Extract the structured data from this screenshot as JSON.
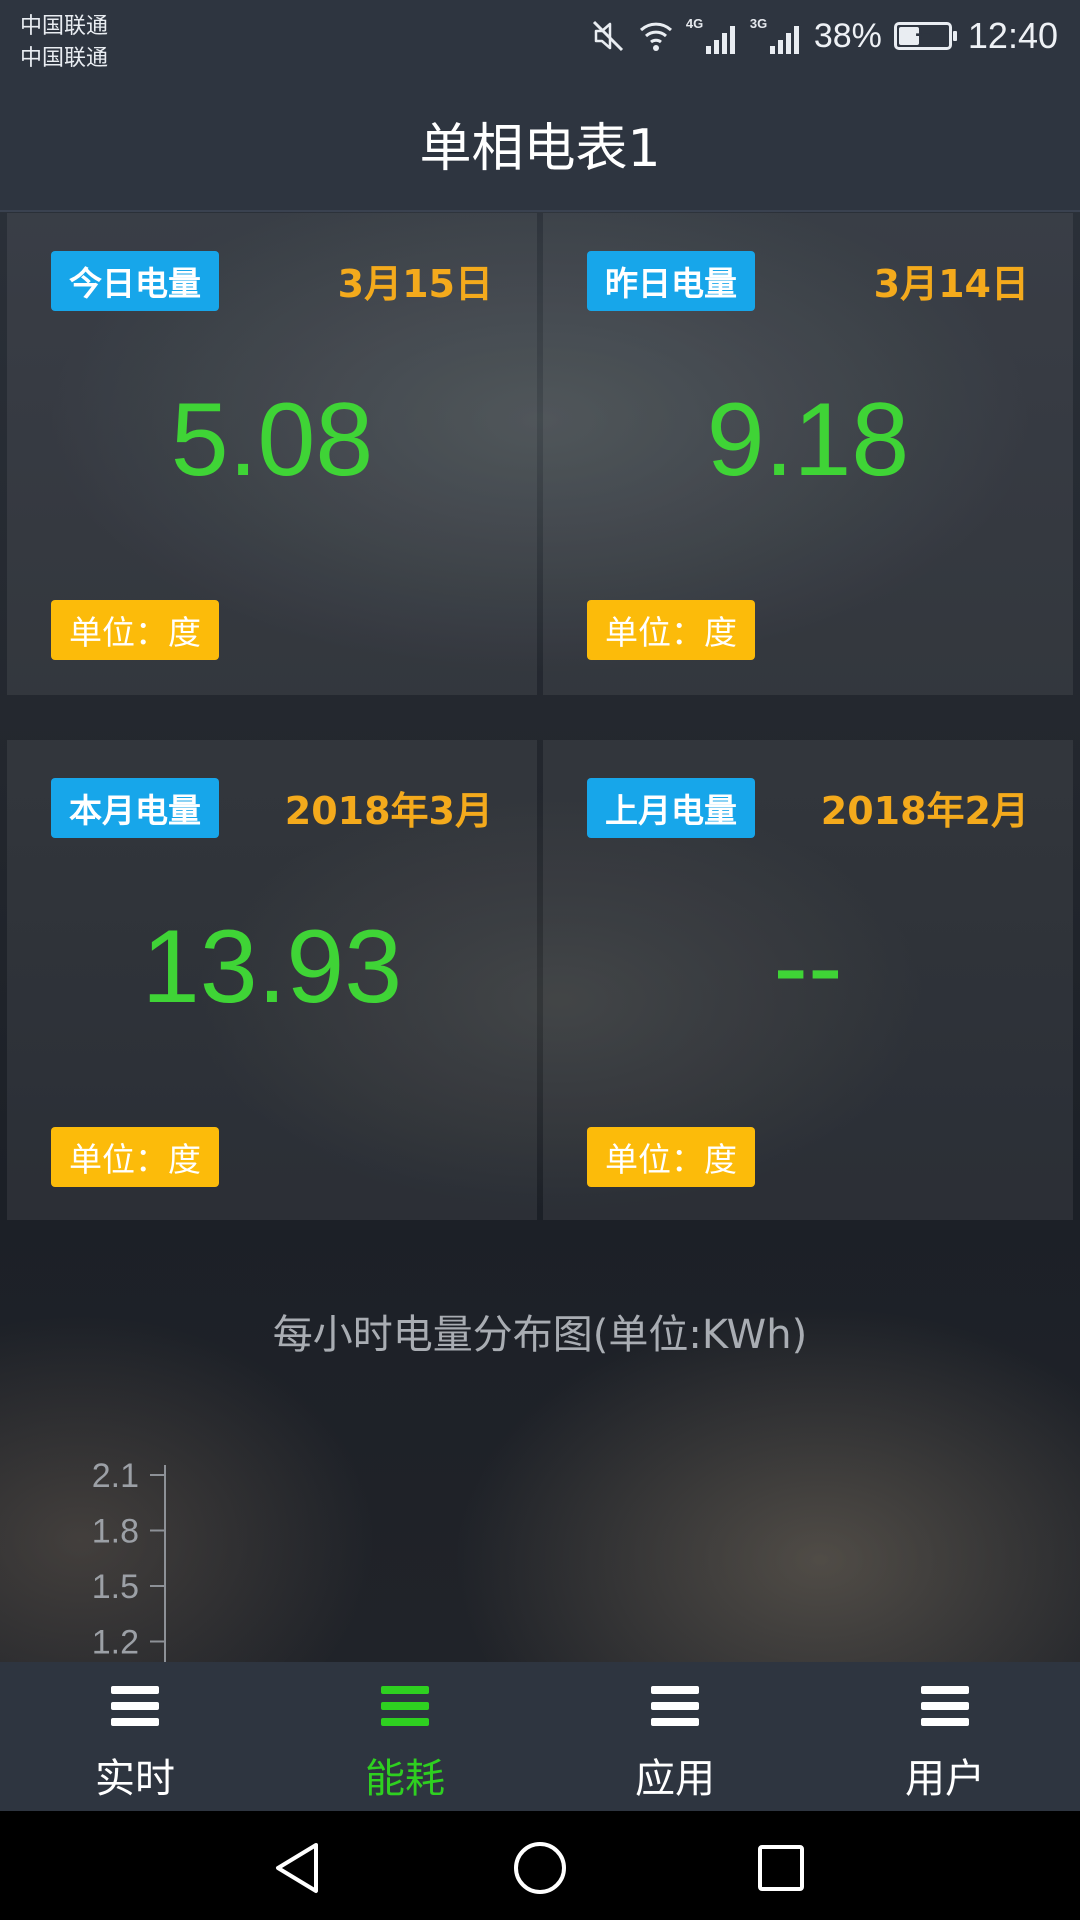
{
  "status_bar": {
    "carrier1": "中国联通",
    "carrier2": "中国联通",
    "net1": "4G",
    "net2": "3G",
    "battery": "38%",
    "time": "12:40",
    "icons": [
      "mute-icon",
      "wifi-icon",
      "signal-icon",
      "battery-charging-icon"
    ]
  },
  "header": {
    "title": "单相电表1"
  },
  "cards": [
    {
      "label": "今日电量",
      "date": "3月15日",
      "value": "5.08",
      "unit": "单位：度"
    },
    {
      "label": "昨日电量",
      "date": "3月14日",
      "value": "9.18",
      "unit": "单位：度"
    },
    {
      "label": "本月电量",
      "date": "2018年3月",
      "value": "13.93",
      "unit": "单位：度"
    },
    {
      "label": "上月电量",
      "date": "2018年2月",
      "value": "--",
      "unit": "单位：度"
    }
  ],
  "chart_data": {
    "type": "bar",
    "title": "每小时电量分布图(单位:KWh)",
    "y_ticks": [
      "2.1",
      "1.8",
      "1.5",
      "1.2"
    ],
    "ylim": [
      1.2,
      2.1
    ],
    "values": []
  },
  "bottom_nav": [
    {
      "label": "实时",
      "icon": "menu-icon",
      "active": false
    },
    {
      "label": "能耗",
      "icon": "menu-icon",
      "active": true
    },
    {
      "label": "应用",
      "icon": "menu-icon",
      "active": false
    },
    {
      "label": "用户",
      "icon": "menu-icon",
      "active": false
    }
  ],
  "colors": {
    "value_green": "#3fd436",
    "label_blue": "#17a6ea",
    "unit_amber": "#fcbb0a",
    "date_orange": "#f4aa1c",
    "nav_active": "#2ed020"
  }
}
